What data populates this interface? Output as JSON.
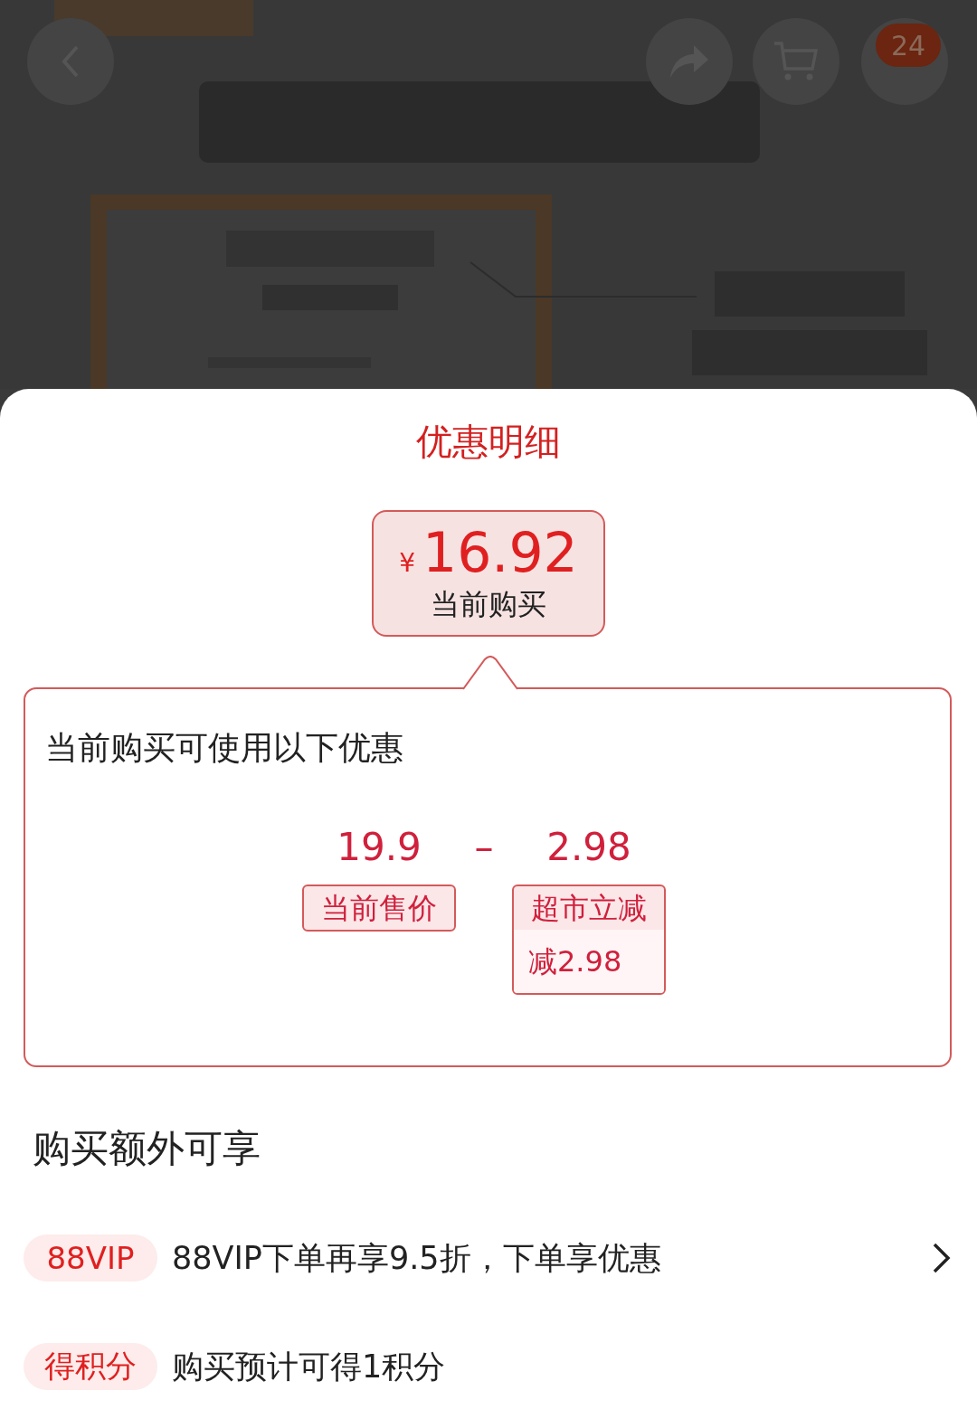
{
  "header": {
    "badge": "24"
  },
  "sheet": {
    "title": "优惠明细",
    "price": {
      "currency": "¥",
      "amount": "16.92",
      "label": "当前购买"
    },
    "discount_card": {
      "heading": "当前购买可使用以下优惠",
      "terms": [
        {
          "kind": "value",
          "amount": "19.9",
          "tag": "当前售价"
        },
        {
          "kind": "operator",
          "symbol": "–"
        },
        {
          "kind": "value",
          "amount": "2.98",
          "tag": "超市立减",
          "detail": "减2.98"
        }
      ]
    },
    "extras": {
      "title": "购买额外可享",
      "items": [
        {
          "badge": "88VIP",
          "text": "88VIP下单再享9.5折，下单享优惠",
          "has_arrow": true
        },
        {
          "badge": "得积分",
          "text": "购买预计可得1积分",
          "has_arrow": false
        }
      ]
    }
  }
}
